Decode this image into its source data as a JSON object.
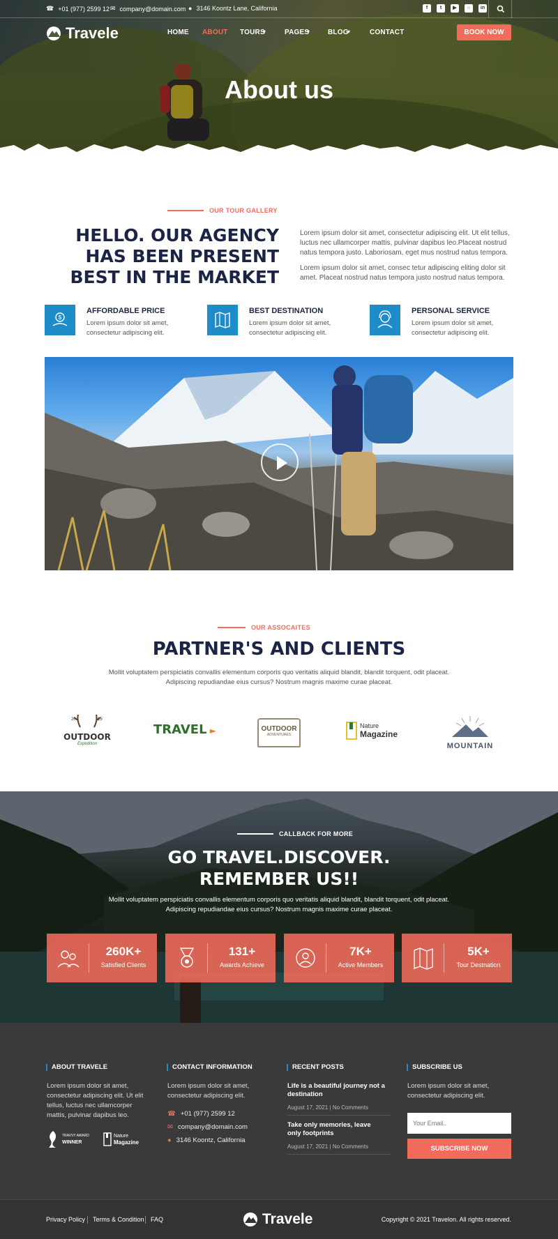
{
  "topbar": {
    "phone": "+01 (977) 2599 12",
    "email": "company@domain.com",
    "address": "3146 Koontz Lane, California",
    "social": [
      "facebook-icon",
      "twitter-icon",
      "youtube-icon",
      "instagram-icon",
      "linkedin-icon"
    ]
  },
  "brand": {
    "name": "Travele"
  },
  "nav": {
    "items": [
      {
        "label": "HOME"
      },
      {
        "label": "ABOUT"
      },
      {
        "label": "TOURS"
      },
      {
        "label": "PAGES"
      },
      {
        "label": "BLOG"
      },
      {
        "label": "CONTACT"
      }
    ],
    "book_label": "BOOK NOW"
  },
  "hero": {
    "title": "About us"
  },
  "intro": {
    "eyebrow": "OUR TOUR GALLERY",
    "heading_lines": [
      "HELLO. OUR AGENCY",
      "HAS BEEN PRESENT",
      "BEST IN THE MARKET"
    ],
    "para1": "Lorem ipsum dolor sit amet, consectetur adipiscing elit. Ut elit tellus, luctus nec ullamcorper mattis, pulvinar dapibus leo.Placeat nostrud natus tempora justo. Laboriosam, eget mus nostrud natus tempora.",
    "para2": "Lorem ipsum dolor sit amet, consec tetur adipiscing eliting dolor sit amet. Placeat nostrud natus tempora justo nostrud natus tempora."
  },
  "features": [
    {
      "title": "AFFORDABLE PRICE",
      "text": "Lorem ipsum dolor sit amet, consectetur adipiscing elit."
    },
    {
      "title": "BEST DESTINATION",
      "text": "Lorem ipsum dolor sit amet, consectetur adipiscing elit."
    },
    {
      "title": "PERSONAL SERVICE",
      "text": "Lorem ipsum dolor sit amet, consectetur adipiscing elit."
    }
  ],
  "partners": {
    "eyebrow": "OUR ASSOCAITES",
    "heading": "PARTNER'S AND CLIENTS",
    "text": "Mollit voluptatem perspiciatis convallis elementum corporis quo veritatis aliquid blandit, blandit torquent, odit placeat. Adipiscing repudiandae eius cursus? Nostrum magnis maxime curae placeat.",
    "logos": [
      {
        "l1": "20",
        "l2": "15",
        "l3": "OUTDOOR",
        "l4": "Expedition"
      },
      {
        "l1": "TRAVEL"
      },
      {
        "l1": "OUTDOOR",
        "l2": "ADVENTURES"
      },
      {
        "l1": "Nature",
        "l2": "Magazine"
      },
      {
        "l1": "MOUNTAIN"
      }
    ]
  },
  "callback": {
    "eyebrow": "CALLBACK FOR MORE",
    "heading_lines": [
      "GO TRAVEL.DISCOVER.",
      "REMEMBER US!!"
    ],
    "text": "Mollit voluptatem perspiciatis convallis elementum corporis quo veritatis aliquid blandit, blandit torquent, odit placeat. Adipiscing repudiandae eius cursus? Nostrum magnis maxime curae placeat.",
    "stats": [
      {
        "value": "260K+",
        "label": "Satisfied Clients",
        "icon": "clients-icon"
      },
      {
        "value": "131+",
        "label": "Awards Achieve",
        "icon": "award-icon"
      },
      {
        "value": "7K+",
        "label": "Active Members",
        "icon": "member-icon"
      },
      {
        "value": "5K+",
        "label": "Tour Destnation",
        "icon": "map-icon"
      }
    ]
  },
  "footer": {
    "about": {
      "title": "ABOUT TRAVELE",
      "text": "Lorem ipsum dolor sit amet, consectetur adipiscing elit. Ut elit tellus, luctus nec ullamcorper mattis, pulvinar dapibus leo.",
      "badge1_l1": "TRAVVY AWARD",
      "badge1_l2": "WINNER",
      "badge2_l1": "Nature",
      "badge2_l2": "Magazine"
    },
    "contact": {
      "title": "CONTACT INFORMATION",
      "text": "Lorem ipsum dolor sit amet, consectetur adipiscing elit.",
      "phone": "+01 (977) 2599 12",
      "email": "company@domain.com",
      "address": "3146 Koontz, California"
    },
    "posts": {
      "title": "RECENT POSTS",
      "items": [
        {
          "title": "Life is a beautiful journey not a destination",
          "date": "August 17, 2021",
          "comments": "No Comments"
        },
        {
          "title": "Take only memories, leave only footprints",
          "date": "August 17, 2021",
          "comments": "No Comments"
        }
      ]
    },
    "subscribe": {
      "title": "SUBSCRIBE US",
      "text": "Lorem ipsum dolor sit amet, consectetur adipiscing elit.",
      "placeholder": "Your Email..",
      "button": "SUBSCRIBE NOW"
    },
    "bottom": {
      "links": [
        "Privacy Policy",
        "Terms & Condition",
        "FAQ"
      ],
      "brand": "Travele",
      "copyright": "Copyright © 2021 Travelon. All rights reserved."
    }
  },
  "colors": {
    "accent": "#f26b5b",
    "navy": "#1b2444",
    "blue": "#1d8cc8",
    "footer": "#3a3a3a"
  }
}
